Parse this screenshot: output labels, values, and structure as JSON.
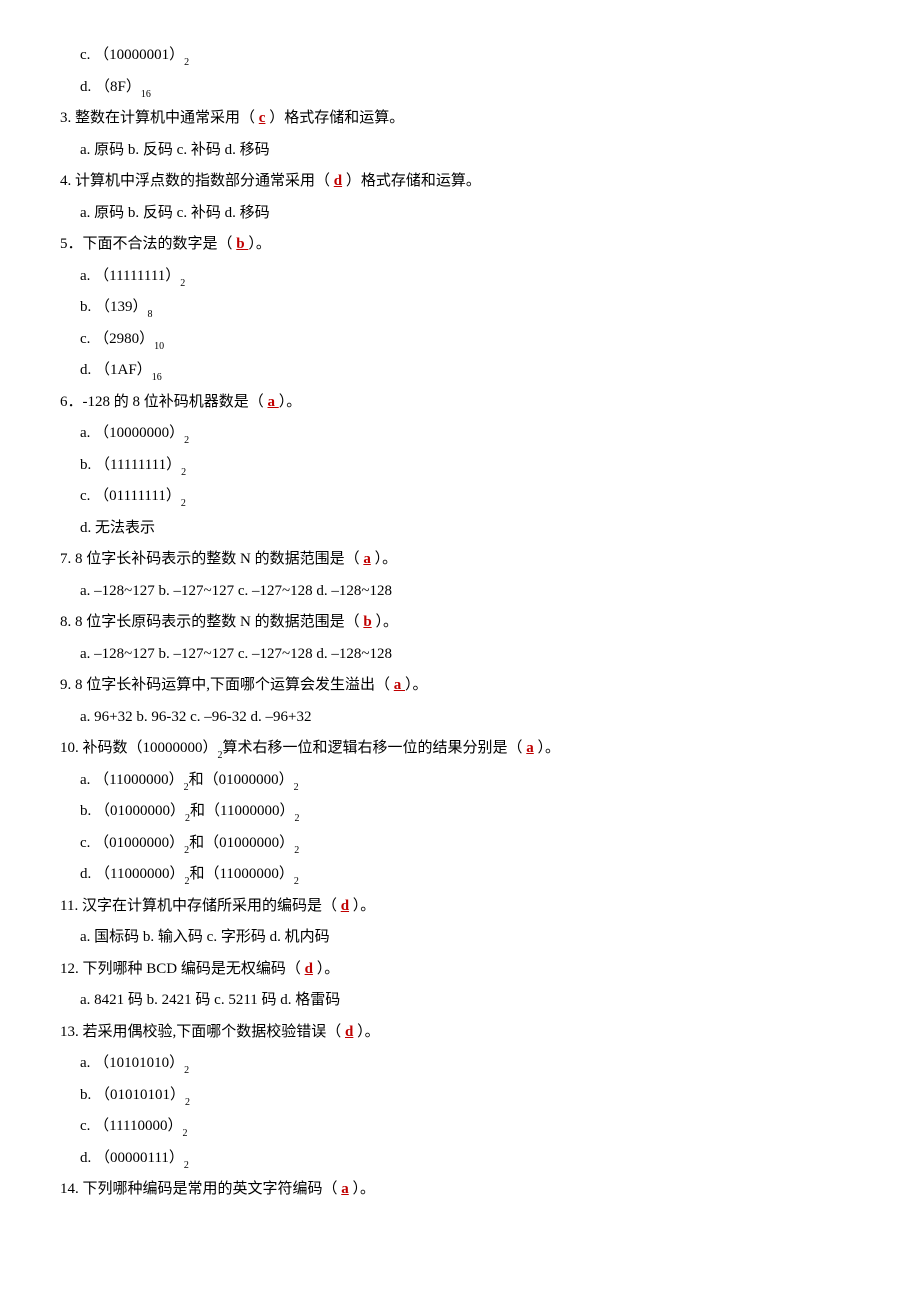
{
  "lines": [
    {
      "cls": "indent-opt",
      "segments": [
        {
          "t": "c. （10000001）"
        },
        {
          "t": "2",
          "sub": true
        }
      ]
    },
    {
      "cls": "indent-opt",
      "segments": [
        {
          "t": "d. （8F）"
        },
        {
          "t": "16",
          "sub": true
        }
      ]
    },
    {
      "cls": "indent-q",
      "segments": [
        {
          "t": "3.  整数在计算机中通常采用（ "
        },
        {
          "t": "c",
          "ans": true
        },
        {
          "t": " ）格式存储和运算。"
        }
      ]
    },
    {
      "cls": "indent-opt",
      "segments": [
        {
          "t": "a.  原码  b.  反码  c.  补码  d.  移码"
        }
      ]
    },
    {
      "cls": "indent-q",
      "segments": [
        {
          "t": "4.  计算机中浮点数的指数部分通常采用（ "
        },
        {
          "t": "d",
          "ans": true
        },
        {
          "t": " ）格式存储和运算。"
        }
      ]
    },
    {
      "cls": "indent-opt",
      "segments": [
        {
          "t": "a.  原码  b.  反码  c.  补码  d.  移码"
        }
      ]
    },
    {
      "cls": "indent-q",
      "segments": [
        {
          "t": "5．下面不合法的数字是（ "
        },
        {
          "t": "b ",
          "ans": true
        },
        {
          "t": "）。"
        }
      ]
    },
    {
      "cls": "indent-opt",
      "segments": [
        {
          "t": "a. （11111111）"
        },
        {
          "t": "2",
          "sub": true
        }
      ]
    },
    {
      "cls": "indent-opt",
      "segments": [
        {
          "t": "b. （139）"
        },
        {
          "t": "8",
          "sub": true
        }
      ]
    },
    {
      "cls": "indent-opt",
      "segments": [
        {
          "t": "c. （2980）"
        },
        {
          "t": "10",
          "sub": true
        }
      ]
    },
    {
      "cls": "indent-opt",
      "segments": [
        {
          "t": "d. （1AF）"
        },
        {
          "t": "16",
          "sub": true
        }
      ]
    },
    {
      "cls": "indent-q",
      "segments": [
        {
          "t": "6．-128  的  8  位补码机器数是（ "
        },
        {
          "t": "a ",
          "ans": true
        },
        {
          "t": "）。"
        }
      ]
    },
    {
      "cls": "indent-opt",
      "segments": [
        {
          "t": "a. （10000000）"
        },
        {
          "t": "2",
          "sub": true
        }
      ]
    },
    {
      "cls": "indent-opt",
      "segments": [
        {
          "t": "b. （11111111）"
        },
        {
          "t": "2",
          "sub": true
        }
      ]
    },
    {
      "cls": "indent-opt",
      "segments": [
        {
          "t": "c. （01111111）"
        },
        {
          "t": "2",
          "sub": true
        }
      ]
    },
    {
      "cls": "indent-opt",
      "segments": [
        {
          "t": "d.  无法表示"
        }
      ]
    },
    {
      "cls": "indent-q",
      "segments": [
        {
          "t": "7. 8  位字长补码表示的整数  N  的数据范围是（ "
        },
        {
          "t": "a",
          "ans": true
        },
        {
          "t": " ）。"
        }
      ]
    },
    {
      "cls": "indent-opt2",
      "segments": [
        {
          "t": "a. –128~127    b. –127~127    c. –127~128    d. –128~128"
        }
      ]
    },
    {
      "cls": "indent-q",
      "segments": [
        {
          "t": "8. 8 位字长原码表示的整数  N  的数据范围是（ "
        },
        {
          "t": "b",
          "ans": true
        },
        {
          "t": " ）。"
        }
      ]
    },
    {
      "cls": "indent-opt2",
      "segments": [
        {
          "t": "a. –128~127    b. –127~127    c. –127~128    d. –128~128"
        }
      ]
    },
    {
      "cls": "indent-q",
      "segments": [
        {
          "t": "9. 8  位字长补码运算中,下面哪个运算会发生溢出（ "
        },
        {
          "t": "a ",
          "ans": true
        },
        {
          "t": "）。"
        }
      ]
    },
    {
      "cls": "indent-opt2",
      "segments": [
        {
          "t": "a. 96+32 b. 96-32 c. –96-32 d. –96+32"
        }
      ]
    },
    {
      "cls": "indent-q",
      "segments": [
        {
          "t": "10.  补码数（10000000）"
        },
        {
          "t": "2",
          "sub": true
        },
        {
          "t": "算术右移一位和逻辑右移一位的结果分别是（ "
        },
        {
          "t": "a",
          "ans": true
        },
        {
          "t": " ）。"
        }
      ]
    },
    {
      "cls": "indent-opt",
      "segments": [
        {
          "t": "a. （11000000）"
        },
        {
          "t": "2",
          "sub": true
        },
        {
          "t": "和（01000000）"
        },
        {
          "t": "2",
          "sub": true
        }
      ]
    },
    {
      "cls": "indent-opt",
      "segments": [
        {
          "t": "b. （01000000）"
        },
        {
          "t": "2",
          "sub": true
        },
        {
          "t": "和（11000000）"
        },
        {
          "t": "2",
          "sub": true
        }
      ]
    },
    {
      "cls": "indent-opt",
      "segments": [
        {
          "t": "c. （01000000）"
        },
        {
          "t": "2",
          "sub": true
        },
        {
          "t": "和（01000000）"
        },
        {
          "t": "2",
          "sub": true
        }
      ]
    },
    {
      "cls": "indent-opt",
      "segments": [
        {
          "t": "d. （11000000）"
        },
        {
          "t": "2",
          "sub": true
        },
        {
          "t": "和（11000000）"
        },
        {
          "t": "2",
          "sub": true
        }
      ]
    },
    {
      "cls": "indent-q",
      "segments": [
        {
          "t": "11.  汉字在计算机中存储所采用的编码是（ "
        },
        {
          "t": "d",
          "ans": true
        },
        {
          "t": " ）。"
        }
      ]
    },
    {
      "cls": "indent-opt",
      "segments": [
        {
          "t": "a.  国标码  b.  输入码  c.  字形码  d.  机内码"
        }
      ]
    },
    {
      "cls": "indent-q",
      "segments": [
        {
          "t": "12.  下列哪种  BCD  编码是无权编码（ "
        },
        {
          "t": "d",
          "ans": true
        },
        {
          "t": " ）。"
        }
      ]
    },
    {
      "cls": "indent-opt",
      "segments": [
        {
          "t": "a. 8421  码  b. 2421  码  c. 5211  码  d.  格雷码"
        }
      ]
    },
    {
      "cls": "indent-q",
      "segments": [
        {
          "t": "13.  若采用偶校验,下面哪个数据校验错误（ "
        },
        {
          "t": "d",
          "ans": true
        },
        {
          "t": " ）。"
        }
      ]
    },
    {
      "cls": "indent-opt",
      "segments": [
        {
          "t": "a. （10101010）"
        },
        {
          "t": "2",
          "sub": true
        }
      ]
    },
    {
      "cls": "indent-opt",
      "segments": [
        {
          "t": "b. （01010101）"
        },
        {
          "t": "2",
          "sub": true
        }
      ]
    },
    {
      "cls": "indent-opt",
      "segments": [
        {
          "t": "c. （11110000）"
        },
        {
          "t": "2",
          "sub": true
        }
      ]
    },
    {
      "cls": "indent-opt",
      "segments": [
        {
          "t": "d. （00000111）"
        },
        {
          "t": "2",
          "sub": true
        }
      ]
    },
    {
      "cls": "indent-q",
      "segments": [
        {
          "t": "14.  下列哪种编码是常用的英文字符编码（ "
        },
        {
          "t": "a",
          "ans": true
        },
        {
          "t": " ）。"
        }
      ]
    }
  ]
}
